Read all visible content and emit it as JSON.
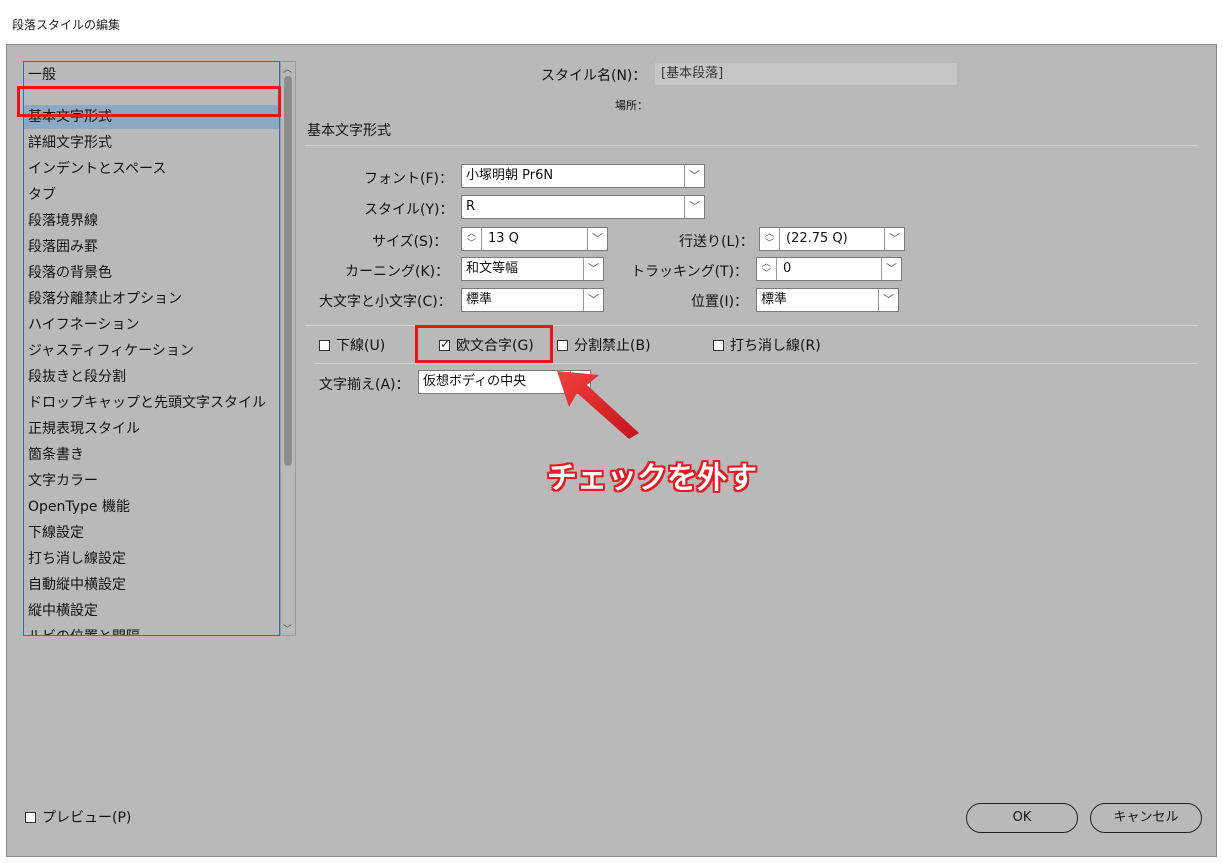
{
  "window": {
    "title": "段落スタイルの編集"
  },
  "sidebar": {
    "items": [
      "一般",
      "基本文字形式",
      "詳細文字形式",
      "インデントとスペース",
      "タブ",
      "段落境界線",
      "段落囲み罫",
      "段落の背景色",
      "段落分離禁止オプション",
      "ハイフネーション",
      "ジャスティフィケーション",
      "段抜きと段分割",
      "ドロップキャップと先頭文字スタイル",
      "正規表現スタイル",
      "箇条書き",
      "文字カラー",
      "OpenType 機能",
      "下線設定",
      "打ち消し線設定",
      "自動縦中横設定",
      "縦中横設定",
      "ルビの位置と間隔"
    ],
    "selected": "基本文字形式"
  },
  "header": {
    "style_name_label": "スタイル名(N)：",
    "style_name_value": "[基本段落]",
    "location_label": "場所：",
    "section_title": "基本文字形式"
  },
  "form": {
    "font_label": "フォント(F)：",
    "font_value": "小塚明朝  Pr6N",
    "style_label": "スタイル(Y)：",
    "style_value": "R",
    "size_label": "サイズ(S)：",
    "size_value": "13 Q",
    "leading_label": "行送り(L)：",
    "leading_value": "(22.75 Q)",
    "kerning_label": "カーニング(K)：",
    "kerning_value": "和文等幅",
    "tracking_label": "トラッキング(T)：",
    "tracking_value": "0",
    "case_label": "大文字と小文字(C)：",
    "case_value": "標準",
    "position_label": "位置(I)：",
    "position_value": "標準",
    "align_label": "文字揃え(A)：",
    "align_value": "仮想ボディの中央"
  },
  "checkboxes": {
    "underline": {
      "label": "下線(U)",
      "checked": false
    },
    "ligature": {
      "label": "欧文合字(G)",
      "checked": true
    },
    "no_break": {
      "label": "分割禁止(B)",
      "checked": false
    },
    "strikethrough": {
      "label": "打ち消し線(R)",
      "checked": false
    }
  },
  "footer": {
    "preview_label": "プレビュー(P)",
    "ok_label": "OK",
    "cancel_label": "キャンセル"
  },
  "annotation": {
    "text": "チェックを外す",
    "color": "#e31b23"
  }
}
